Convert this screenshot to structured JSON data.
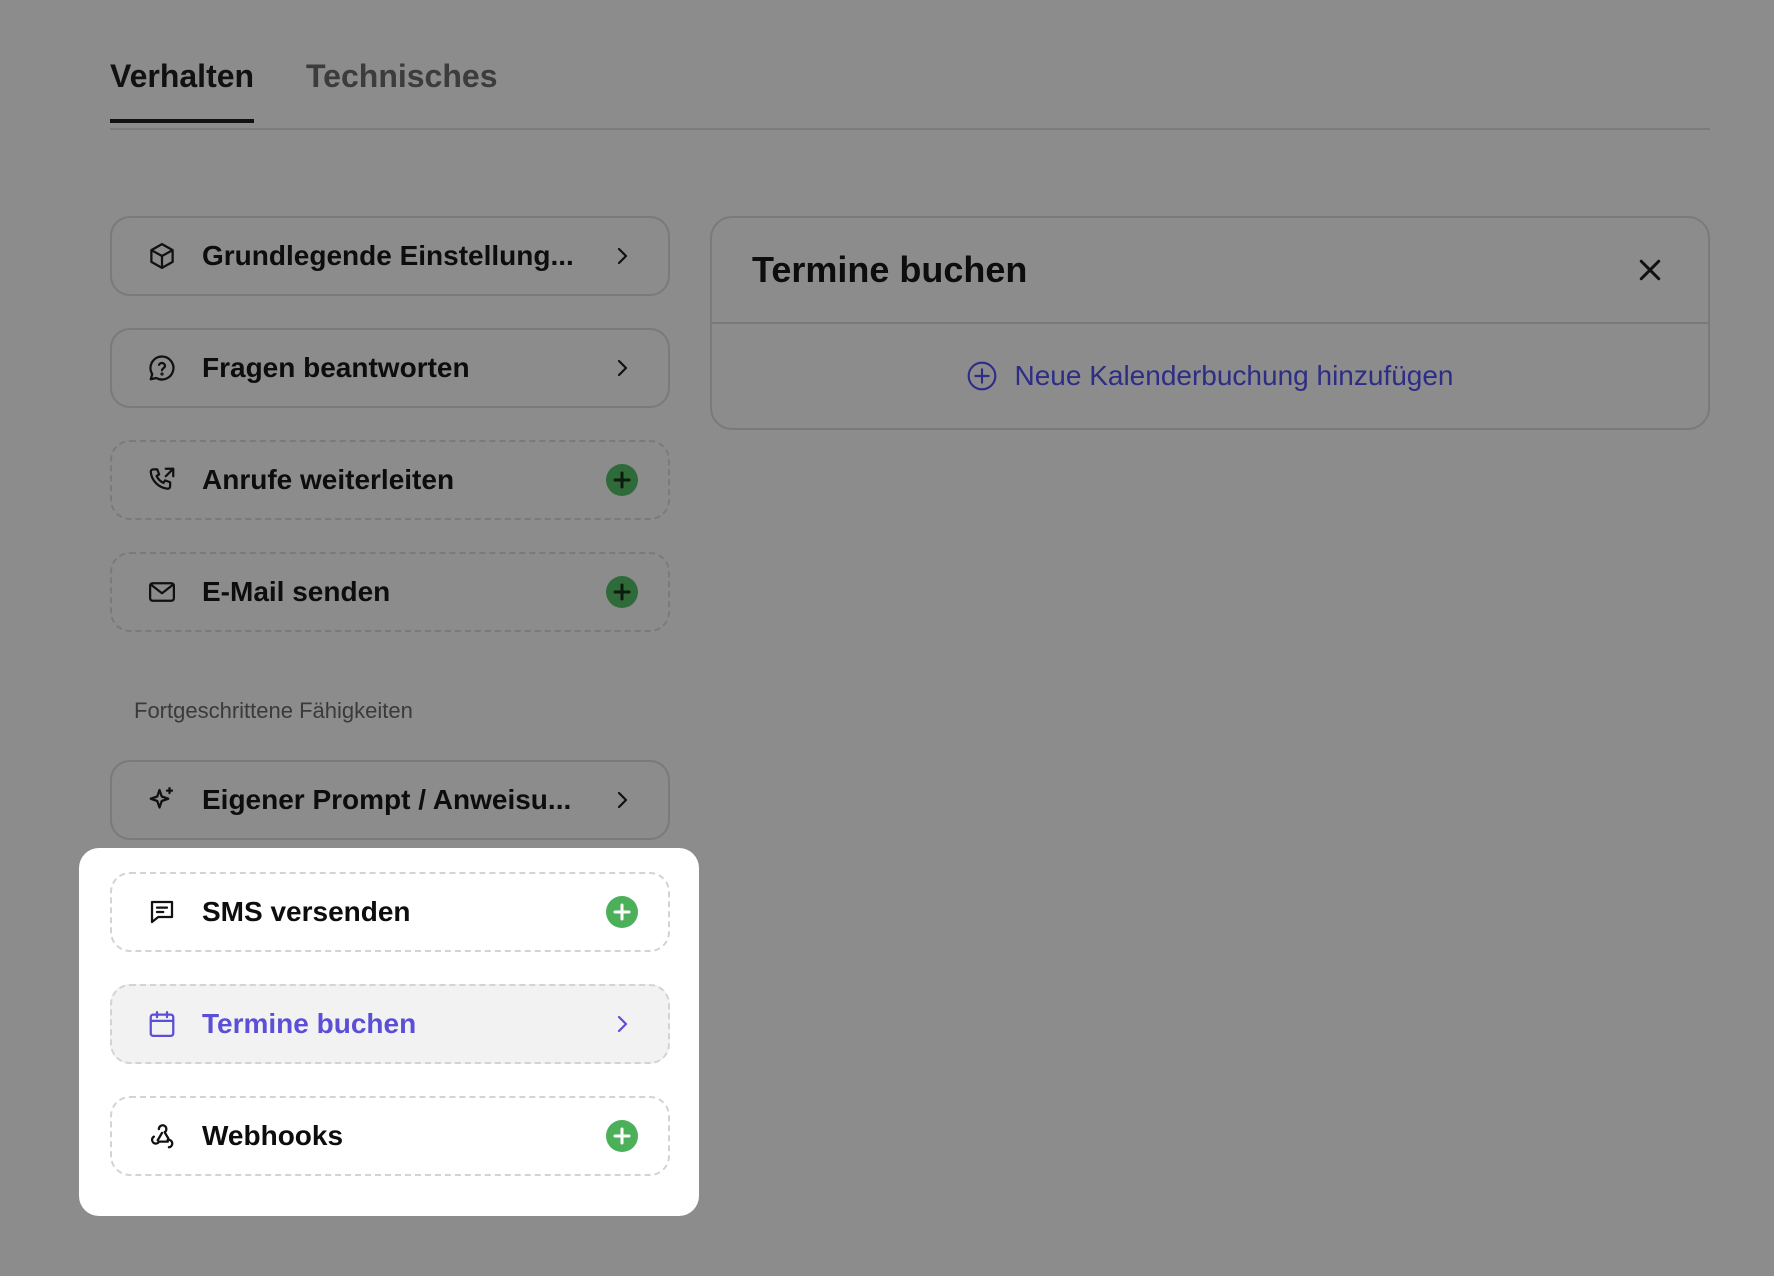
{
  "tabs": [
    {
      "label": "Verhalten",
      "active": true
    },
    {
      "label": "Technisches",
      "active": false
    }
  ],
  "basic_items": [
    {
      "icon": "cube-icon",
      "label": "Grundlegende Einstellung...",
      "action": "chevron"
    },
    {
      "icon": "question-chat-icon",
      "label": "Fragen beantworten",
      "action": "chevron"
    },
    {
      "icon": "phone-forward-icon",
      "label": "Anrufe weiterleiten",
      "action": "add"
    },
    {
      "icon": "mail-icon",
      "label": "E-Mail senden",
      "action": "add"
    }
  ],
  "advanced_section_label": "Fortgeschrittene Fähigkeiten",
  "advanced_items": [
    {
      "icon": "sparkle-icon",
      "label": "Eigener Prompt / Anweisu...",
      "action": "chevron"
    },
    {
      "icon": "message-icon",
      "label": "SMS versenden",
      "action": "add"
    },
    {
      "icon": "calendar-icon",
      "label": "Termine buchen",
      "action": "chevron",
      "selected": true
    },
    {
      "icon": "webhook-icon",
      "label": "Webhooks",
      "action": "add"
    }
  ],
  "detail_panel": {
    "title": "Termine buchen",
    "add_label": "Neue Kalenderbuchung hinzufügen"
  },
  "colors": {
    "backdrop": "#8c8c8c",
    "accent": "#5b4fd6",
    "add_green_dim": "#2e6b39",
    "add_green": "#4caf5a",
    "link_dim": "#2d2d88"
  }
}
